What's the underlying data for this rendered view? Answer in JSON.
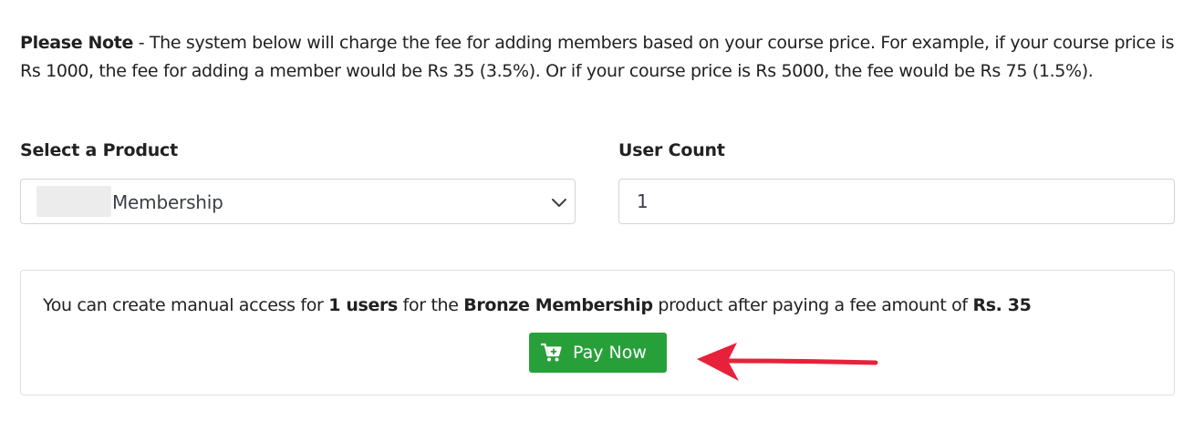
{
  "note": {
    "prefix": "Please Note",
    "text": " - The system below will charge the fee for adding members based on your course price. For example, if your course price is Rs 1000, the fee for adding a member would be Rs 35 (3.5%). Or if your course price is Rs 5000, the fee would be Rs 75 (1.5%)."
  },
  "form": {
    "product_label": "Select a Product",
    "product_value": "Membership",
    "count_label": "User Count",
    "count_value": "1"
  },
  "summary": {
    "part1": "You can create manual access for ",
    "users": "1 users",
    "part2": " for the ",
    "product": "Bronze Membership",
    "part3": " product after paying a fee amount of ",
    "amount": "Rs. 35"
  },
  "pay_button": {
    "label": "Pay Now",
    "color": "#28a03a",
    "icon": "cart-plus-icon"
  },
  "annotation": {
    "arrow_color": "#e8213b"
  }
}
